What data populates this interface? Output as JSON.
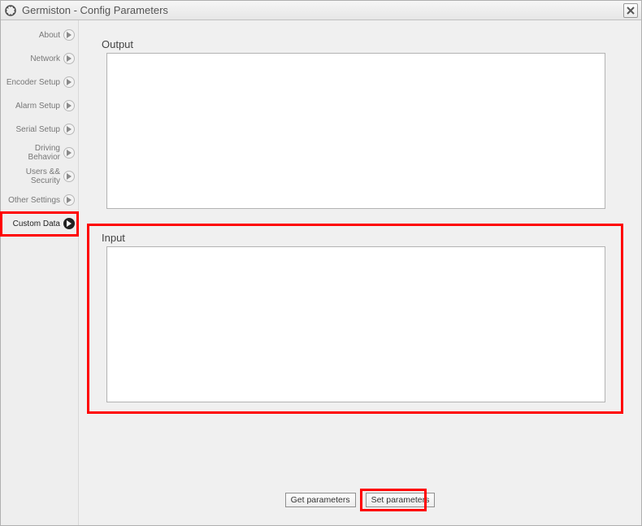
{
  "window": {
    "title": "Germiston - Config Parameters"
  },
  "sidebar": {
    "items": [
      {
        "label": "About",
        "active": false
      },
      {
        "label": "Network",
        "active": false
      },
      {
        "label": "Encoder Setup",
        "active": false
      },
      {
        "label": "Alarm Setup",
        "active": false
      },
      {
        "label": "Serial Setup",
        "active": false
      },
      {
        "label": "Driving Behavior",
        "active": false
      },
      {
        "label": "Users && Security",
        "active": false
      },
      {
        "label": "Other Settings",
        "active": false
      },
      {
        "label": "Custom Data",
        "active": true,
        "highlighted": true
      }
    ]
  },
  "main": {
    "output_label": "Output",
    "output_value": "",
    "input_label": "Input",
    "input_value": ""
  },
  "buttons": {
    "get_parameters": "Get parameters",
    "set_parameters": "Set parameters"
  },
  "highlights": {
    "input_section": true,
    "set_parameters_button": true,
    "custom_data_sidebar": true
  }
}
